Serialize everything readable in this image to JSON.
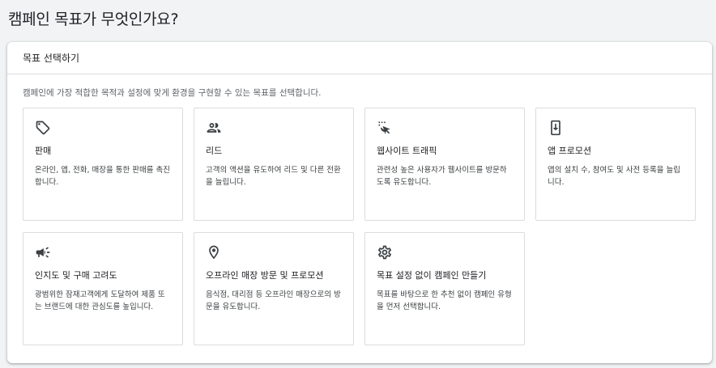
{
  "page": {
    "title": "캠페인 목표가 무엇인가요?"
  },
  "card": {
    "header": "목표 선택하기",
    "description": "캠페인에 가장 적합한 목적과 설정에 맞게 환경을 구현할 수 있는 목표를 선택합니다."
  },
  "goals": [
    {
      "icon": "tag-icon",
      "title": "판매",
      "desc": "온라인, 앱, 전화, 매장을 통한 판매를 촉진합니다."
    },
    {
      "icon": "people-icon",
      "title": "리드",
      "desc": "고객의 액션을 유도하여 리드 및 다른 전환을 늘립니다."
    },
    {
      "icon": "cursor-click-icon",
      "title": "웹사이트 트래픽",
      "desc": "관련성 높은 사용자가 웹사이트를 방문하도록 유도합니다."
    },
    {
      "icon": "phone-download-icon",
      "title": "앱 프로모션",
      "desc": "앱의 설치 수, 참여도 및 사전 등록을 늘립니다."
    },
    {
      "icon": "megaphone-icon",
      "title": "인지도 및 구매 고려도",
      "desc": "광범위한 잠재고객에게 도달하여 제품 또는 브랜드에 대한 관심도를 높입니다."
    },
    {
      "icon": "location-pin-icon",
      "title": "오프라인 매장 방문 및 프로모션",
      "desc": "음식점, 대리점 등 오프라인 매장으로의 방문을 유도합니다."
    },
    {
      "icon": "gear-icon",
      "title": "목표 설정 없이 캠페인 만들기",
      "desc": "목표를 바탕으로 한 추천 없이 캠페인 유형을 먼저 선택합니다."
    }
  ]
}
